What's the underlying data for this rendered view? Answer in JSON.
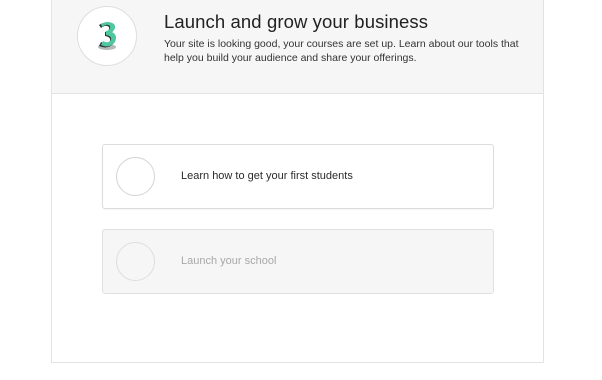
{
  "header": {
    "badge_icon": "step-3-icon",
    "title": "Launch and grow your business",
    "description": "Your site is looking good, your courses are set up. Learn about our tools that help you build your audience and share your offerings."
  },
  "tasks": [
    {
      "label": "Learn how to get your first students",
      "enabled": true
    },
    {
      "label": "Launch your school",
      "enabled": false
    }
  ],
  "colors": {
    "badge_accent": "#4fc7a0",
    "badge_dark": "#2b3a36",
    "header_bg": "#f6f6f6"
  }
}
